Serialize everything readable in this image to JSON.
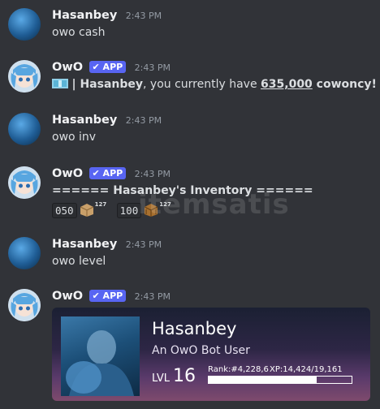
{
  "messages": [
    {
      "author": "Hasanbey",
      "time": "2:43 PM",
      "text": "owo cash"
    },
    {
      "author": "OwO",
      "badge": "✔ APP",
      "time": "2:43 PM",
      "cash": {
        "pre": "| ",
        "name": "Hasanbey",
        "mid": ", you currently have ",
        "amount": "635,000",
        "post": " cowoncy!"
      }
    },
    {
      "author": "Hasanbey",
      "time": "2:43 PM",
      "text": "owo inv"
    },
    {
      "author": "OwO",
      "badge": "✔ APP",
      "time": "2:43 PM",
      "inv": {
        "title": "====== Hasanbey's Inventory ======",
        "items": [
          {
            "code": "050",
            "count": "127"
          },
          {
            "code": "100",
            "count": "127"
          }
        ]
      }
    },
    {
      "author": "Hasanbey",
      "time": "2:43 PM",
      "text": "owo level"
    },
    {
      "author": "OwO",
      "badge": "✔ APP",
      "time": "2:43 PM",
      "card": {
        "name": "Hasanbey",
        "subtitle": "An OwO Bot User",
        "lvl_label": "LVL",
        "level": "16",
        "rank": "Rank:#4,228,6",
        "xp": "XP:14,424/19,161",
        "progress": 0.753
      }
    }
  ],
  "watermark": "itemsatis"
}
